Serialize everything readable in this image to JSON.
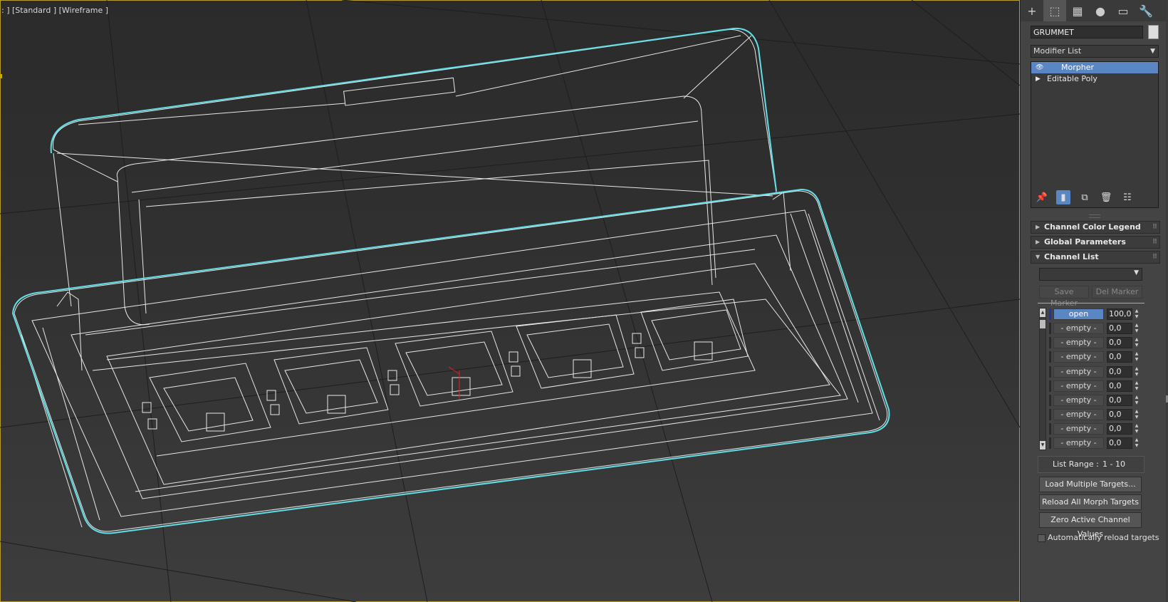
{
  "viewport": {
    "label": ": ] [Standard ] [Wireframe ]",
    "accent_color": "#5fe0e8"
  },
  "command_panel": {
    "tabs": [
      {
        "icon": "create-icon",
        "glyph": "+"
      },
      {
        "icon": "modify-icon",
        "glyph": "⬚"
      },
      {
        "icon": "hierarchy-icon",
        "glyph": "▦"
      },
      {
        "icon": "motion-icon",
        "glyph": "●"
      },
      {
        "icon": "display-icon",
        "glyph": "▭"
      },
      {
        "icon": "utilities-icon",
        "glyph": "🔧"
      }
    ],
    "object_name": "GRUMMET",
    "modifier_list": "Modifier List",
    "stack": [
      {
        "label": "Morpher",
        "selected": true
      },
      {
        "label": "Editable Poly",
        "selected": false
      }
    ],
    "rollouts": {
      "channel_color_legend": "Channel Color Legend",
      "global_parameters": "Global Parameters",
      "channel_list": "Channel List"
    },
    "save_marker": "Save Marker",
    "del_marker": "Del Marker",
    "channels": [
      {
        "name": "open",
        "value": "100,0"
      },
      {
        "name": "- empty -",
        "value": "0,0"
      },
      {
        "name": "- empty -",
        "value": "0,0"
      },
      {
        "name": "- empty -",
        "value": "0,0"
      },
      {
        "name": "- empty -",
        "value": "0,0"
      },
      {
        "name": "- empty -",
        "value": "0,0"
      },
      {
        "name": "- empty -",
        "value": "0,0"
      },
      {
        "name": "- empty -",
        "value": "0,0"
      },
      {
        "name": "- empty -",
        "value": "0,0"
      },
      {
        "name": "- empty -",
        "value": "0,0"
      }
    ],
    "list_range_label": "List Range :",
    "list_range_value": "1 - 10",
    "load_multiple": "Load Multiple Targets...",
    "reload_all": "Reload All Morph Targets",
    "zero_active": "Zero Active Channel Values",
    "auto_reload": "Automatically reload targets"
  }
}
